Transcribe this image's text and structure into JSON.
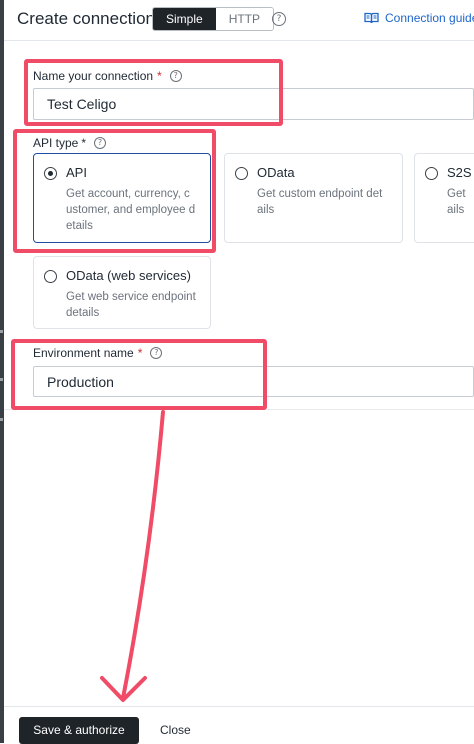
{
  "header": {
    "title": "Create connection",
    "toggle": {
      "simple": "Simple",
      "http": "HTTP"
    },
    "help_glyph": "?",
    "guide_label": "Connection guide"
  },
  "form": {
    "connection_name": {
      "label": "Name your connection",
      "required_mark": "*",
      "value": "Test Celigo"
    },
    "api_type": {
      "label": "API type",
      "required_mark": "*",
      "options": [
        {
          "title": "API",
          "desc": "Get account, currency, c ustomer, and employee d etails",
          "selected": true
        },
        {
          "title": "OData",
          "desc": "Get custom endpoint det ails",
          "selected": false
        },
        {
          "title": "S2S",
          "desc": "Get ails",
          "selected": false
        },
        {
          "title": "OData (web services)",
          "desc": "Get web service endpoint details",
          "selected": false
        }
      ]
    },
    "environment": {
      "label": "Environment name",
      "required_mark": "*",
      "value": "Production"
    }
  },
  "footer": {
    "primary_label": "Save & authorize",
    "secondary_label": "Close"
  },
  "colors": {
    "highlight": "#f04b67",
    "accent": "#1f66c9",
    "selected_border": "#1f4ea3",
    "primary_button": "#1f2428"
  },
  "icons": [
    "help-icon",
    "book-icon",
    "radio-icon",
    "arrow-annotation"
  ]
}
